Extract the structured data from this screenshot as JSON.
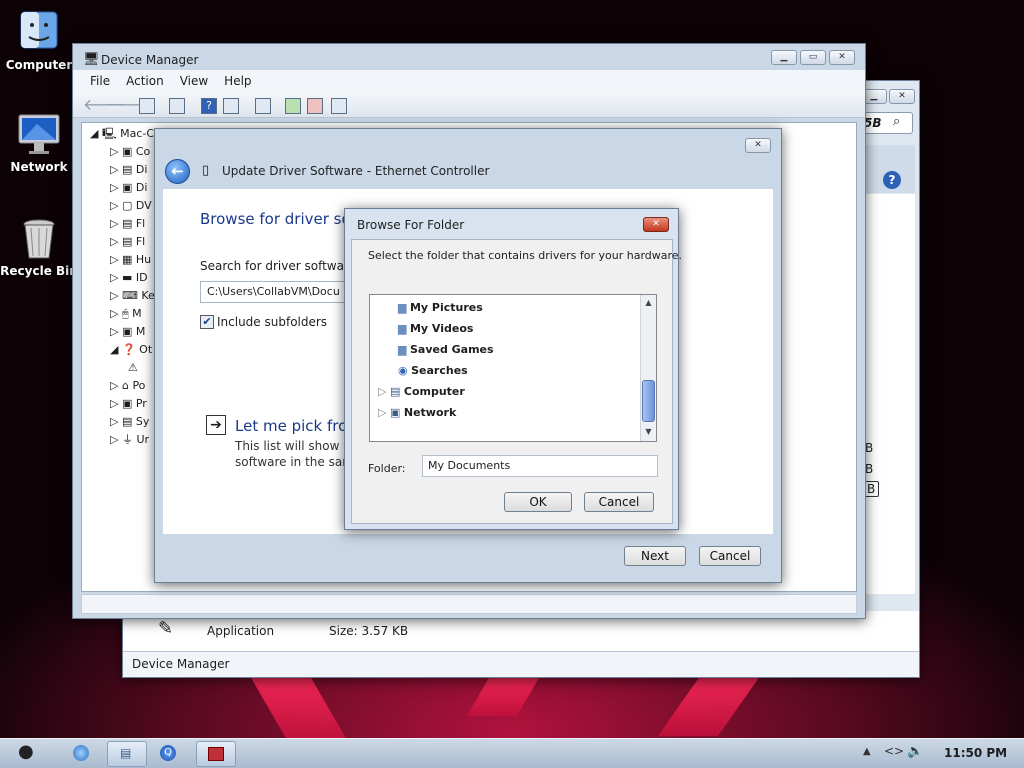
{
  "desktop": {
    "icons": [
      {
        "label": "Computer"
      },
      {
        "label": "Network"
      },
      {
        "label": "Recycle Bin"
      }
    ]
  },
  "back_window": {
    "search_fragment": "5B",
    "status": "Device Manager",
    "file_type": "Application",
    "file_size": "Size: 3.57 KB",
    "side_fragments": [
      "B",
      "B",
      "B"
    ]
  },
  "device_manager": {
    "title": "Device Manager",
    "menu": [
      "File",
      "Action",
      "View",
      "Help"
    ],
    "tree_root": "Mac-C",
    "tree_items": [
      "Co",
      "Di",
      "Di",
      "DV",
      "Fl",
      "Fl",
      "Hu",
      "ID",
      "Ke",
      "M",
      "M",
      "Ot",
      "",
      "Po",
      "Pr",
      "Sy",
      "Ur"
    ]
  },
  "update_driver": {
    "title": "Update Driver Software - Ethernet Controller",
    "heading": "Browse for driver sof",
    "search_label": "Search for driver software in",
    "path_value": "C:\\Users\\CollabVM\\Docu",
    "include_subfolders": "Include subfolders",
    "pick_title": "Let me pick from",
    "pick_desc_1": "This list will show inst",
    "pick_desc_2": "software in the same",
    "next": "Next",
    "cancel": "Cancel"
  },
  "browse_folder": {
    "title": "Browse For Folder",
    "instruction": "Select the folder that contains drivers for your hardware.",
    "items": [
      {
        "label": "My Pictures",
        "icon": "folder-icon"
      },
      {
        "label": "My Videos",
        "icon": "folder-icon"
      },
      {
        "label": "Saved Games",
        "icon": "folder-icon"
      },
      {
        "label": "Searches",
        "icon": "search-icon"
      },
      {
        "label": "Computer",
        "icon": "computer-icon"
      },
      {
        "label": "Network",
        "icon": "network-icon"
      }
    ],
    "folder_label": "Folder:",
    "folder_value": "My Documents",
    "ok": "OK",
    "cancel": "Cancel"
  },
  "taskbar": {
    "clock": "11:50 PM"
  }
}
